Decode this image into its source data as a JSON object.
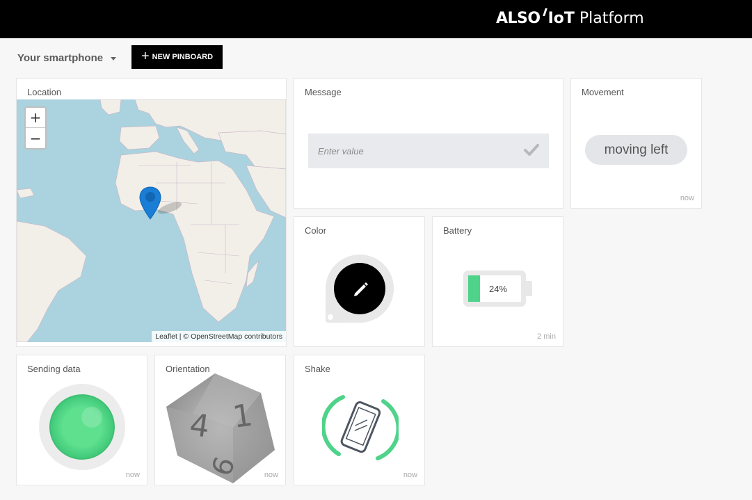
{
  "header": {
    "brand_also": "ALSO",
    "brand_iot": "IoT",
    "brand_platform": "Platform"
  },
  "toolbar": {
    "device_name": "Your smartphone",
    "new_pinboard_label": "NEW PINBOARD"
  },
  "cards": {
    "location": {
      "title": "Location",
      "zoom_in": "+",
      "zoom_out": "−",
      "attribution": "Leaflet | © OpenStreetMap contributors"
    },
    "message": {
      "title": "Message",
      "placeholder": "Enter value"
    },
    "movement": {
      "title": "Movement",
      "value": "moving left",
      "time": "now"
    },
    "color": {
      "title": "Color",
      "icon": "pencil-icon"
    },
    "battery": {
      "title": "Battery",
      "level_percent": 24,
      "level_label": "24%",
      "time": "2 min"
    },
    "sending_data": {
      "title": "Sending data",
      "time": "now"
    },
    "orientation": {
      "title": "Orientation",
      "time": "now",
      "dice_faces": [
        "1",
        "4",
        "6"
      ]
    },
    "shake": {
      "title": "Shake",
      "time": "now"
    }
  },
  "colors": {
    "header_bg": "#000000",
    "accent_green": "#4fd38a",
    "marker_blue": "#1a7ed6",
    "map_water": "#aad3df",
    "map_land": "#f2efe9",
    "pill_bg": "#e3e5e8"
  }
}
